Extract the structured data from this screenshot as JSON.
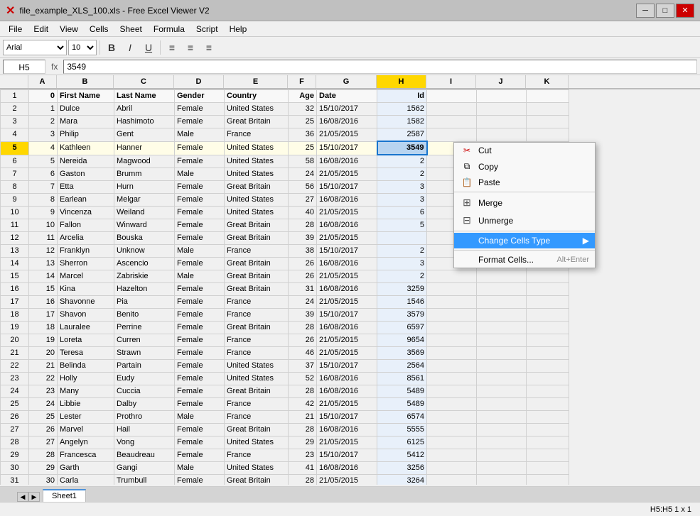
{
  "titlebar": {
    "app_icon": "✕",
    "title": "file_example_XLS_100.xls - Free Excel Viewer V2",
    "minimize": "─",
    "maximize": "□",
    "close": "✕"
  },
  "menubar": {
    "items": [
      "File",
      "Edit",
      "View",
      "Cells",
      "Sheet",
      "Formula",
      "Script",
      "Help"
    ]
  },
  "formula_bar": {
    "cell_ref": "H5",
    "fx": "fx",
    "formula": "3549"
  },
  "columns": {
    "headers": [
      "",
      "A",
      "B",
      "C",
      "D",
      "E",
      "F",
      "G",
      "H",
      "I",
      "J",
      "K"
    ],
    "widths": [
      40,
      40,
      80,
      85,
      70,
      90,
      40,
      85,
      70,
      70,
      60,
      60
    ]
  },
  "rows": [
    {
      "num": 1,
      "cells": [
        "0",
        "First Name",
        "Last Name",
        "Gender",
        "Country",
        "Age",
        "Date",
        "Id",
        "",
        "",
        ""
      ]
    },
    {
      "num": 2,
      "cells": [
        "1",
        "Dulce",
        "Abril",
        "Female",
        "United States",
        "32",
        "15/10/2017",
        "1562",
        "",
        "",
        ""
      ]
    },
    {
      "num": 3,
      "cells": [
        "2",
        "Mara",
        "Hashimoto",
        "Female",
        "Great Britain",
        "25",
        "16/08/2016",
        "1582",
        "",
        "",
        ""
      ]
    },
    {
      "num": 4,
      "cells": [
        "3",
        "Philip",
        "Gent",
        "Male",
        "France",
        "36",
        "21/05/2015",
        "2587",
        "",
        "",
        ""
      ]
    },
    {
      "num": 5,
      "cells": [
        "4",
        "Kathleen",
        "Hanner",
        "Female",
        "United States",
        "25",
        "15/10/2017",
        "3549",
        "",
        "",
        ""
      ]
    },
    {
      "num": 6,
      "cells": [
        "5",
        "Nereida",
        "Magwood",
        "Female",
        "United States",
        "58",
        "16/08/2016",
        "2",
        "",
        "",
        ""
      ]
    },
    {
      "num": 7,
      "cells": [
        "6",
        "Gaston",
        "Brumm",
        "Male",
        "United States",
        "24",
        "21/05/2015",
        "2",
        "",
        "",
        ""
      ]
    },
    {
      "num": 8,
      "cells": [
        "7",
        "Etta",
        "Hurn",
        "Female",
        "Great Britain",
        "56",
        "15/10/2017",
        "3",
        "",
        "",
        ""
      ]
    },
    {
      "num": 9,
      "cells": [
        "8",
        "Earlean",
        "Melgar",
        "Female",
        "United States",
        "27",
        "16/08/2016",
        "3",
        "",
        "",
        ""
      ]
    },
    {
      "num": 10,
      "cells": [
        "9",
        "Vincenza",
        "Weiland",
        "Female",
        "United States",
        "40",
        "21/05/2015",
        "6",
        "",
        "",
        ""
      ]
    },
    {
      "num": 11,
      "cells": [
        "10",
        "Fallon",
        "Winward",
        "Female",
        "Great Britain",
        "28",
        "16/08/2016",
        "5",
        "",
        "",
        ""
      ]
    },
    {
      "num": 12,
      "cells": [
        "11",
        "Arcelia",
        "Bouska",
        "Female",
        "Great Britain",
        "39",
        "21/05/2015",
        "",
        "",
        "",
        ""
      ]
    },
    {
      "num": 13,
      "cells": [
        "12",
        "Franklyn",
        "Unknow",
        "Male",
        "France",
        "38",
        "15/10/2017",
        "2",
        "",
        "",
        ""
      ]
    },
    {
      "num": 14,
      "cells": [
        "13",
        "Sherron",
        "Ascencio",
        "Female",
        "Great Britain",
        "26",
        "16/08/2016",
        "3",
        "",
        "",
        ""
      ]
    },
    {
      "num": 15,
      "cells": [
        "14",
        "Marcel",
        "Zabriskie",
        "Male",
        "Great Britain",
        "26",
        "21/05/2015",
        "2",
        "",
        "",
        ""
      ]
    },
    {
      "num": 16,
      "cells": [
        "15",
        "Kina",
        "Hazelton",
        "Female",
        "Great Britain",
        "31",
        "16/08/2016",
        "3259",
        "",
        "",
        ""
      ]
    },
    {
      "num": 17,
      "cells": [
        "16",
        "Shavonne",
        "Pia",
        "Female",
        "France",
        "24",
        "21/05/2015",
        "1546",
        "",
        "",
        ""
      ]
    },
    {
      "num": 18,
      "cells": [
        "17",
        "Shavon",
        "Benito",
        "Female",
        "France",
        "39",
        "15/10/2017",
        "3579",
        "",
        "",
        ""
      ]
    },
    {
      "num": 19,
      "cells": [
        "18",
        "Lauralee",
        "Perrine",
        "Female",
        "Great Britain",
        "28",
        "16/08/2016",
        "6597",
        "",
        "",
        ""
      ]
    },
    {
      "num": 20,
      "cells": [
        "19",
        "Loreta",
        "Curren",
        "Female",
        "France",
        "26",
        "21/05/2015",
        "9654",
        "",
        "",
        ""
      ]
    },
    {
      "num": 21,
      "cells": [
        "20",
        "Teresa",
        "Strawn",
        "Female",
        "France",
        "46",
        "21/05/2015",
        "3569",
        "",
        "",
        ""
      ]
    },
    {
      "num": 22,
      "cells": [
        "21",
        "Belinda",
        "Partain",
        "Female",
        "United States",
        "37",
        "15/10/2017",
        "2564",
        "",
        "",
        ""
      ]
    },
    {
      "num": 23,
      "cells": [
        "22",
        "Holly",
        "Eudy",
        "Female",
        "United States",
        "52",
        "16/08/2016",
        "8561",
        "",
        "",
        ""
      ]
    },
    {
      "num": 24,
      "cells": [
        "23",
        "Many",
        "Cuccia",
        "Female",
        "Great Britain",
        "28",
        "16/08/2016",
        "5489",
        "",
        "",
        ""
      ]
    },
    {
      "num": 25,
      "cells": [
        "24",
        "Libbie",
        "Dalby",
        "Female",
        "France",
        "42",
        "21/05/2015",
        "5489",
        "",
        "",
        ""
      ]
    },
    {
      "num": 26,
      "cells": [
        "25",
        "Lester",
        "Prothro",
        "Male",
        "France",
        "21",
        "15/10/2017",
        "6574",
        "",
        "",
        ""
      ]
    },
    {
      "num": 27,
      "cells": [
        "26",
        "Marvel",
        "Hail",
        "Female",
        "Great Britain",
        "28",
        "16/08/2016",
        "5555",
        "",
        "",
        ""
      ]
    },
    {
      "num": 28,
      "cells": [
        "27",
        "Angelyn",
        "Vong",
        "Female",
        "United States",
        "29",
        "21/05/2015",
        "6125",
        "",
        "",
        ""
      ]
    },
    {
      "num": 29,
      "cells": [
        "28",
        "Francesca",
        "Beaudreau",
        "Female",
        "France",
        "23",
        "15/10/2017",
        "5412",
        "",
        "",
        ""
      ]
    },
    {
      "num": 30,
      "cells": [
        "29",
        "Garth",
        "Gangi",
        "Male",
        "United States",
        "41",
        "16/08/2016",
        "3256",
        "",
        "",
        ""
      ]
    },
    {
      "num": 31,
      "cells": [
        "30",
        "Carla",
        "Trumbull",
        "Female",
        "Great Britain",
        "28",
        "21/05/2015",
        "3264",
        "",
        "",
        ""
      ]
    }
  ],
  "context_menu": {
    "items": [
      {
        "id": "cut",
        "icon": "✂",
        "label": "Cut",
        "shortcut": ""
      },
      {
        "id": "copy",
        "icon": "⧉",
        "label": "Copy",
        "shortcut": ""
      },
      {
        "id": "paste",
        "icon": "📋",
        "label": "Paste",
        "shortcut": ""
      },
      {
        "id": "sep1"
      },
      {
        "id": "merge",
        "icon": "⊞",
        "label": "Merge",
        "shortcut": ""
      },
      {
        "id": "unmerge",
        "icon": "⊟",
        "label": "Unmerge",
        "shortcut": ""
      },
      {
        "id": "sep2"
      },
      {
        "id": "change_cells_type",
        "icon": "",
        "label": "Change Cells Type",
        "shortcut": "",
        "arrow": "▶",
        "highlighted": true
      },
      {
        "id": "sep3"
      },
      {
        "id": "format_cells",
        "icon": "",
        "label": "Format Cells...",
        "shortcut": "Alt+Enter"
      }
    ]
  },
  "status_bar": {
    "cell_info": "H5:H5 1 x 1"
  },
  "sheet_tabs": [
    "Sheet1"
  ],
  "zoom": "100%"
}
